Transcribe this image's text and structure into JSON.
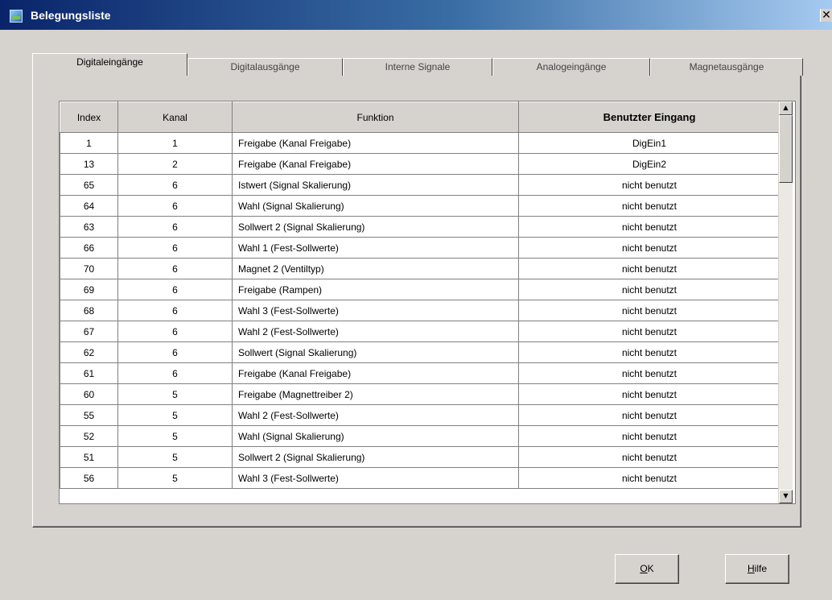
{
  "window": {
    "title": "Belegungsliste",
    "close_glyph": "✕"
  },
  "tabs": [
    {
      "label": "Digitaleingänge",
      "active": true
    },
    {
      "label": "Digitalausgänge",
      "active": false
    },
    {
      "label": "Interne Signale",
      "active": false
    },
    {
      "label": "Analogeingänge",
      "active": false
    },
    {
      "label": "Magnetausgänge",
      "active": false
    }
  ],
  "table": {
    "columns": [
      "Index",
      "Kanal",
      "Funktion",
      "Benutzter Eingang"
    ],
    "rows": [
      {
        "index": "1",
        "kanal": "1",
        "funktion": "Freigabe (Kanal Freigabe)",
        "eingang": "DigEin1"
      },
      {
        "index": "13",
        "kanal": "2",
        "funktion": "Freigabe (Kanal Freigabe)",
        "eingang": "DigEin2"
      },
      {
        "index": "65",
        "kanal": "6",
        "funktion": "Istwert (Signal Skalierung)",
        "eingang": "nicht benutzt"
      },
      {
        "index": "64",
        "kanal": "6",
        "funktion": "Wahl (Signal Skalierung)",
        "eingang": "nicht benutzt"
      },
      {
        "index": "63",
        "kanal": "6",
        "funktion": "Sollwert 2 (Signal Skalierung)",
        "eingang": "nicht benutzt"
      },
      {
        "index": "66",
        "kanal": "6",
        "funktion": "Wahl 1 (Fest-Sollwerte)",
        "eingang": "nicht benutzt"
      },
      {
        "index": "70",
        "kanal": "6",
        "funktion": "Magnet 2 (Ventiltyp)",
        "eingang": "nicht benutzt"
      },
      {
        "index": "69",
        "kanal": "6",
        "funktion": "Freigabe (Rampen)",
        "eingang": "nicht benutzt"
      },
      {
        "index": "68",
        "kanal": "6",
        "funktion": "Wahl 3 (Fest-Sollwerte)",
        "eingang": "nicht benutzt"
      },
      {
        "index": "67",
        "kanal": "6",
        "funktion": "Wahl 2 (Fest-Sollwerte)",
        "eingang": "nicht benutzt"
      },
      {
        "index": "62",
        "kanal": "6",
        "funktion": "Sollwert (Signal Skalierung)",
        "eingang": "nicht benutzt"
      },
      {
        "index": "61",
        "kanal": "6",
        "funktion": "Freigabe (Kanal Freigabe)",
        "eingang": "nicht benutzt"
      },
      {
        "index": "60",
        "kanal": "5",
        "funktion": "Freigabe (Magnettreiber 2)",
        "eingang": "nicht benutzt"
      },
      {
        "index": "55",
        "kanal": "5",
        "funktion": "Wahl 2 (Fest-Sollwerte)",
        "eingang": "nicht benutzt"
      },
      {
        "index": "52",
        "kanal": "5",
        "funktion": "Wahl (Signal Skalierung)",
        "eingang": "nicht benutzt"
      },
      {
        "index": "51",
        "kanal": "5",
        "funktion": "Sollwert 2 (Signal Skalierung)",
        "eingang": "nicht benutzt"
      },
      {
        "index": "56",
        "kanal": "5",
        "funktion": "Wahl 3 (Fest-Sollwerte)",
        "eingang": "nicht benutzt"
      }
    ]
  },
  "scrollbar": {
    "up_glyph": "▲",
    "down_glyph": "▼"
  },
  "buttons": {
    "ok": {
      "mnemonic": "O",
      "rest": "K"
    },
    "help": {
      "mnemonic": "H",
      "rest": "ilfe"
    }
  }
}
